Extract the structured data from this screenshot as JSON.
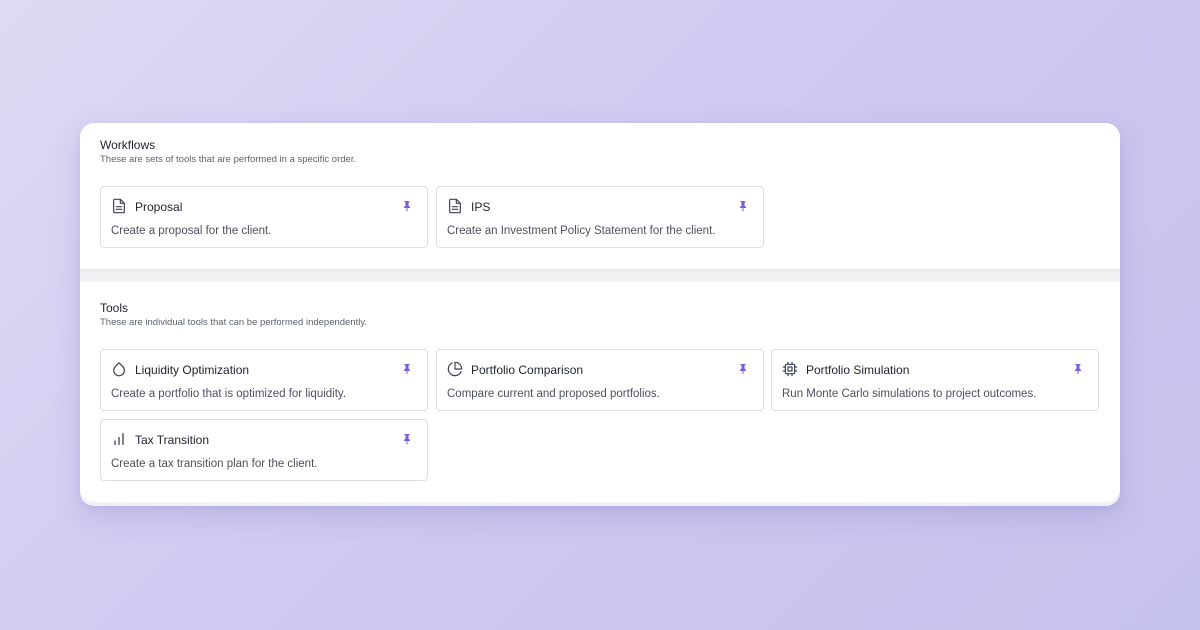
{
  "colors": {
    "accent": "#7c5ce6",
    "icon_stroke": "#3f4252",
    "card_border": "#dcdde3"
  },
  "workflows": {
    "title": "Workflows",
    "subtitle": "These are sets of tools that are performed in a specific order.",
    "cards": [
      {
        "icon": "document-icon",
        "title": "Proposal",
        "description": "Create a proposal for the client.",
        "pinned": true
      },
      {
        "icon": "document-icon",
        "title": "IPS",
        "description": "Create an Investment Policy Statement for the client.",
        "pinned": true
      }
    ]
  },
  "tools": {
    "title": "Tools",
    "subtitle": "These are individual tools that can be performed independently.",
    "cards": [
      {
        "icon": "droplet-icon",
        "title": "Liquidity Optimization",
        "description": "Create a portfolio that is optimized for liquidity.",
        "pinned": true
      },
      {
        "icon": "pie-chart-icon",
        "title": "Portfolio Comparison",
        "description": "Compare current and proposed portfolios.",
        "pinned": true
      },
      {
        "icon": "cpu-chip-icon",
        "title": "Portfolio Simulation",
        "description": "Run Monte Carlo simulations to project outcomes.",
        "pinned": true
      },
      {
        "icon": "bar-chart-icon",
        "title": "Tax Transition",
        "description": "Create a tax transition plan for the client.",
        "pinned": true
      }
    ]
  }
}
